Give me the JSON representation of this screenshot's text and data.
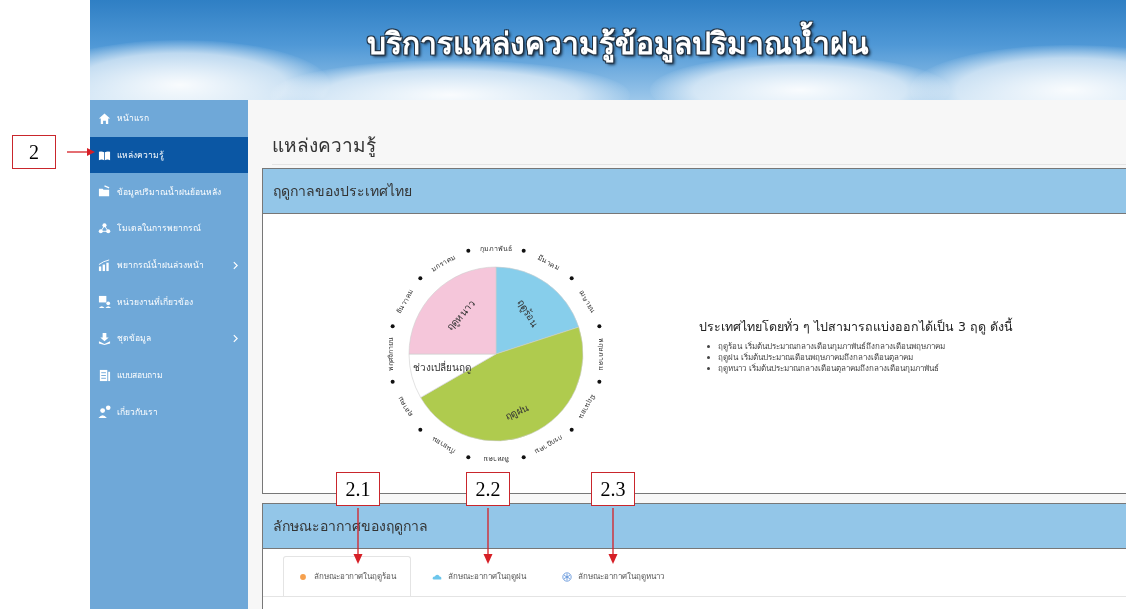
{
  "banner": {
    "title": "บริการแหล่งความรู้ข้อมูลปริมาณน้ำฝน"
  },
  "sidebar": {
    "items": [
      {
        "label": "หน้าแรก",
        "selected": false,
        "expandable": false
      },
      {
        "label": "แหล่งความรู้",
        "selected": true,
        "expandable": false
      },
      {
        "label": "ข้อมูลปริมาณน้ำฝนย้อนหลัง",
        "selected": false,
        "expandable": false
      },
      {
        "label": "โมเดลในการพยากรณ์",
        "selected": false,
        "expandable": false
      },
      {
        "label": "พยากรณ์น้ำฝนล่วงหน้า",
        "selected": false,
        "expandable": true
      },
      {
        "label": "หน่วยงานที่เกี่ยวข้อง",
        "selected": false,
        "expandable": false
      },
      {
        "label": "ชุดข้อมูล",
        "selected": false,
        "expandable": true
      },
      {
        "label": "แบบสอบถาม",
        "selected": false,
        "expandable": false
      },
      {
        "label": "เกี่ยวกับเรา",
        "selected": false,
        "expandable": false
      }
    ]
  },
  "page_title": "แหล่งความรู้",
  "seasons_panel": {
    "title": "ฤดูกาลของประเทศไทย",
    "wheel": {
      "segments": [
        {
          "label": "ฤดูร้อน",
          "color": "#87ceeb"
        },
        {
          "label": "ฤดูฝน",
          "color": "#afcb4e"
        },
        {
          "label": "ช่วงเปลี่ยนฤดู",
          "color": "#ffffff"
        },
        {
          "label": "ฤดูหนาว",
          "color": "#f5c6da"
        }
      ],
      "months": [
        "กุมภาพันธ์",
        "มีนาคม",
        "เมษายน",
        "พฤษภาคม",
        "มิถุนายน",
        "กรกฎาคม",
        "สิงหาคม",
        "กันยายน",
        "ตุลาคม",
        "พฤศจิกายน",
        "ธันวาคม",
        "มกราคม"
      ]
    },
    "intro": {
      "heading": "ประเทศไทยโดยทั่ว ๆ ไปสามารถแบ่งออกได้เป็น 3 ฤดู ดังนี้",
      "bullets": [
        "ฤดูร้อน เริ่มต้นประมาณกลางเดือนกุมภาพันธ์ถึงกลางเดือนพฤษภาคม",
        "ฤดูฝน เริ่มต้นประมาณเดือนพฤษภาคมถึงกลางเดือนตุลาคม",
        "ฤดูหนาว เริ่มต้นประมาณกลางเดือนตุลาคมถึงกลางเดือนกุมภาพันธ์"
      ]
    }
  },
  "climate_panel": {
    "title": "ลักษณะอากาศของฤดูกาล",
    "tabs": [
      {
        "label": "ลักษณะอากาศในฤดูร้อน",
        "selected": true
      },
      {
        "label": "ลักษณะอากาศในฤดูฝน",
        "selected": false
      },
      {
        "label": "ลักษณะอากาศในฤดูหนาว",
        "selected": false
      }
    ]
  },
  "annotations": [
    "2",
    "2.1",
    "2.2",
    "2.3"
  ]
}
